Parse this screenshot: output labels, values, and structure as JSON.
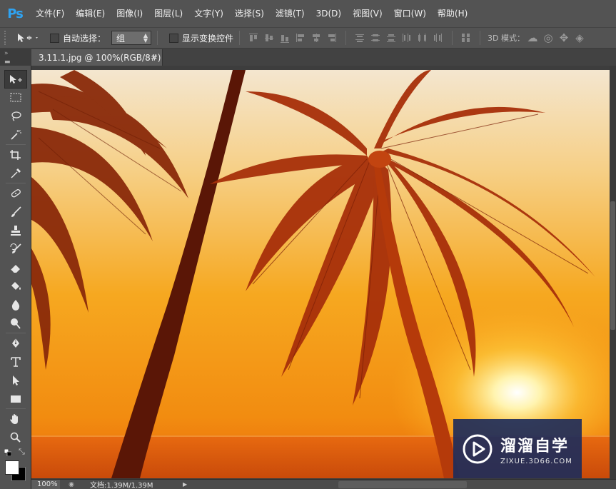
{
  "app": {
    "logo": "Ps"
  },
  "menu": {
    "items": [
      "文件(F)",
      "编辑(E)",
      "图像(I)",
      "图层(L)",
      "文字(Y)",
      "选择(S)",
      "滤镜(T)",
      "3D(D)",
      "视图(V)",
      "窗口(W)",
      "帮助(H)"
    ]
  },
  "options": {
    "auto_select_label": "自动选择：",
    "auto_select_checked": false,
    "auto_select_value": "组",
    "show_transform_label": "显示变换控件",
    "show_transform_checked": false,
    "mode3d_label": "3D 模式："
  },
  "document": {
    "tab_title": "3.11.1.jpg @ 100%(RGB/8#)",
    "close_glyph": "×"
  },
  "toolbar": {
    "tools": [
      "move-tool",
      "marquee-tool",
      "lasso-tool",
      "magic-wand-tool",
      "crop-tool",
      "eyedropper-tool",
      "healing-brush-tool",
      "brush-tool",
      "clone-stamp-tool",
      "history-brush-tool",
      "eraser-tool",
      "paint-bucket-tool",
      "blur-tool",
      "dodge-tool",
      "pen-tool",
      "type-tool",
      "path-selection-tool",
      "rectangle-tool",
      "hand-tool",
      "zoom-tool"
    ],
    "active_tool": "move-tool",
    "foreground_color": "#ffffff",
    "background_color": "#000000"
  },
  "watermark": {
    "title": "溜溜自学",
    "subtitle": "ZIXUE.3D66.COM"
  },
  "status": {
    "zoom": "100%",
    "doc_info": "文档:1.39M/1.39M"
  }
}
